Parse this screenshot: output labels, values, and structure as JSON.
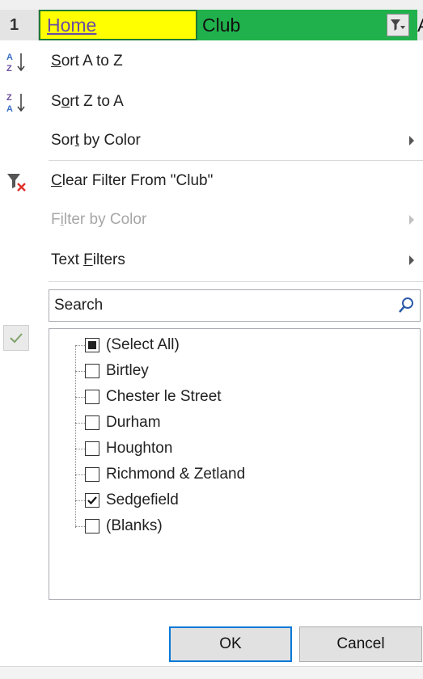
{
  "sheet": {
    "row_number": "1",
    "cell_home": "Home",
    "cell_club": "Club",
    "cell_next": "A"
  },
  "menu": {
    "sort_az": {
      "pre": "",
      "u": "S",
      "post": "ort A to Z"
    },
    "sort_za": {
      "pre": "S",
      "u": "o",
      "post": "rt Z to A"
    },
    "sort_color": {
      "pre": "Sor",
      "u": "t",
      "post": " by Color"
    },
    "clear_filter": {
      "pre": "",
      "u": "C",
      "post": "lear Filter From \"Club\""
    },
    "filter_color": {
      "pre": "F",
      "u": "i",
      "post": "lter by Color"
    },
    "text_filters": {
      "pre": "Text ",
      "u": "F",
      "post": "ilters"
    }
  },
  "search": {
    "value": "Search"
  },
  "list": {
    "items": [
      {
        "label": "(Select All)",
        "state": "partial"
      },
      {
        "label": "Birtley",
        "state": "unchecked"
      },
      {
        "label": "Chester le Street",
        "state": "unchecked"
      },
      {
        "label": "Durham",
        "state": "unchecked"
      },
      {
        "label": "Houghton",
        "state": "unchecked"
      },
      {
        "label": "Richmond & Zetland",
        "state": "unchecked"
      },
      {
        "label": "Sedgefield",
        "state": "checked"
      },
      {
        "label": "(Blanks)",
        "state": "unchecked"
      }
    ]
  },
  "buttons": {
    "ok": "OK",
    "cancel": "Cancel"
  },
  "colors": {
    "home_fill": "#ffff00",
    "club_fill": "#21b14c",
    "ok_border": "#0078d7"
  },
  "icons": {
    "sort_az": "sort-ascending-icon",
    "sort_za": "sort-descending-icon",
    "clear_filter": "clear-filter-icon",
    "search": "search-icon",
    "filter_dropdown": "filter-dropdown-icon"
  }
}
